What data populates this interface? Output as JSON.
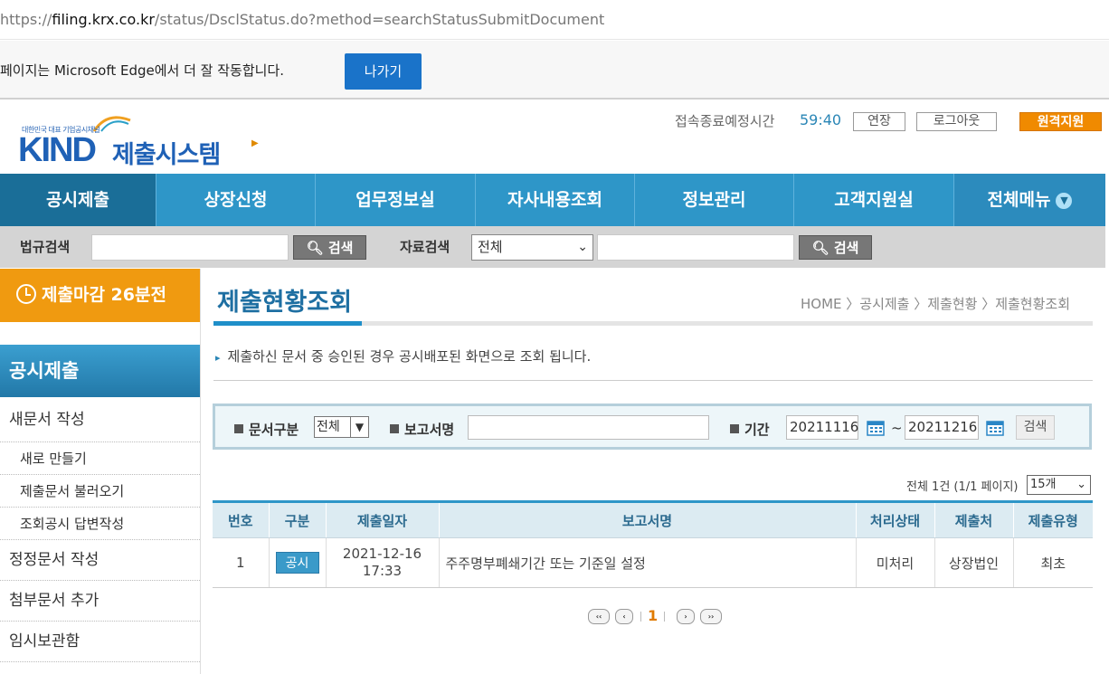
{
  "browser": {
    "url_prefix": "https://",
    "url_host": "filing.krx.co.kr",
    "url_path": "/status/DsclStatus.do?method=searchStatusSubmitDocument",
    "infobar_message": "페이지는 Microsoft Edge에서 더 잘 작동합니다.",
    "infobar_button": "나가기"
  },
  "header": {
    "logo_small": "대한민국 대표 기업공시채널",
    "logo_kind": "KIND",
    "logo_system": "제출시스템",
    "timer_label": "접속종료예정시간",
    "timer_value": "59:40",
    "extend_button": "연장",
    "logout_button": "로그아웃",
    "remote_button": "원격지원"
  },
  "nav": {
    "items": [
      "공시제출",
      "상장신청",
      "업무정보실",
      "자사내용조회",
      "정보관리",
      "고객지원실",
      "전체메뉴"
    ]
  },
  "search": {
    "law_label": "법규검색",
    "search_button": "검색",
    "data_label": "자료검색",
    "data_select": "전체",
    "search_button2": "검색"
  },
  "sidebar": {
    "deadline": "제출마감 26분전",
    "title": "공시제출",
    "items": [
      {
        "label": "새문서 작성",
        "type": "main"
      },
      {
        "label": "새로 만들기",
        "type": "sub"
      },
      {
        "label": "제출문서 불러오기",
        "type": "sub"
      },
      {
        "label": "조회공시 답변작성",
        "type": "sub"
      },
      {
        "label": "정정문서 작성",
        "type": "main"
      },
      {
        "label": "첨부문서 추가",
        "type": "main"
      },
      {
        "label": "임시보관함",
        "type": "main"
      }
    ]
  },
  "main": {
    "title": "제출현황조회",
    "breadcrumb": "HOME 〉공시제출 〉제출현황 〉제출현황조회",
    "notice": "제출하신 문서 중 승인된 경우 공시배포된 화면으로 조회 됩니다.",
    "filter": {
      "doc_type_label": "문서구분",
      "doc_type_value": "전체",
      "report_name_label": "보고서명",
      "period_label": "기간",
      "date_from": "20211116",
      "tilde": "~",
      "date_to": "20211216",
      "search_button": "검색"
    },
    "count_text": "전체 1건 (1/1 페이지)",
    "page_size": "15개",
    "table": {
      "headers": [
        "번호",
        "구분",
        "제출일자",
        "보고서명",
        "처리상태",
        "제출처",
        "제출유형"
      ],
      "rows": [
        {
          "no": "1",
          "type": "공시",
          "date": "2021-12-16",
          "time": "17:33",
          "title": "주주명부폐쇄기간 또는 기준일 설정",
          "status": "미처리",
          "dest": "상장법인",
          "kind": "최초"
        }
      ]
    },
    "pager": {
      "first": "‹‹",
      "prev": "‹",
      "current": "1",
      "next": "›",
      "last": "››"
    }
  }
}
